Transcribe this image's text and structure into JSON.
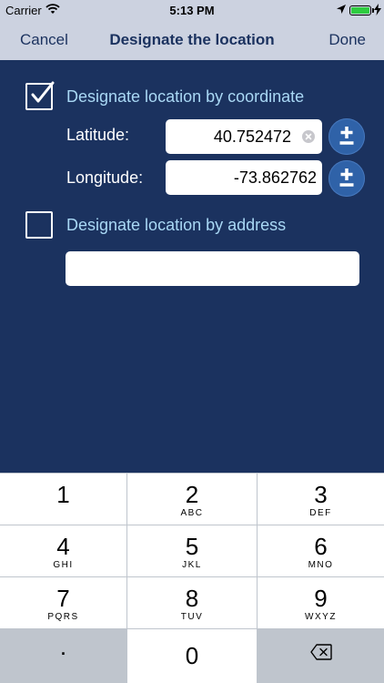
{
  "status_bar": {
    "carrier": "Carrier",
    "time": "5:13 PM"
  },
  "nav": {
    "cancel": "Cancel",
    "title": "Designate the location",
    "done": "Done"
  },
  "by_coordinate": {
    "label": "Designate location by coordinate",
    "checked": true,
    "latitude": {
      "label": "Latitude:",
      "value": "40.752472"
    },
    "longitude": {
      "label": "Longitude:",
      "value": "-73.862762"
    }
  },
  "by_address": {
    "label": "Designate location by address",
    "checked": false,
    "value": ""
  },
  "keypad": {
    "keys": [
      {
        "digit": "1",
        "letters": ""
      },
      {
        "digit": "2",
        "letters": "ABC"
      },
      {
        "digit": "3",
        "letters": "DEF"
      },
      {
        "digit": "4",
        "letters": "GHI"
      },
      {
        "digit": "5",
        "letters": "JKL"
      },
      {
        "digit": "6",
        "letters": "MNO"
      },
      {
        "digit": "7",
        "letters": "PQRS"
      },
      {
        "digit": "8",
        "letters": "TUV"
      },
      {
        "digit": "9",
        "letters": "WXYZ"
      }
    ],
    "dot": ".",
    "zero": "0"
  },
  "colors": {
    "background": "#1b325f",
    "bar": "#ccd2e0",
    "option_label": "#a9d8f5",
    "stepper": "#2f62a8"
  }
}
